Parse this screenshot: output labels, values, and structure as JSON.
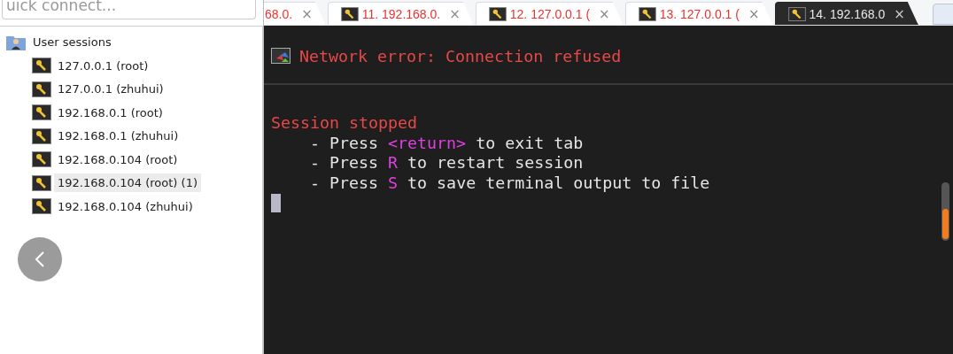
{
  "quick_connect": {
    "placeholder": "uick connect..."
  },
  "sessions": {
    "label": "User sessions",
    "children": [
      {
        "label": "127.0.0.1 (root)",
        "selected": false
      },
      {
        "label": "127.0.0.1 (zhuhui)",
        "selected": false
      },
      {
        "label": "192.168.0.1 (root)",
        "selected": false
      },
      {
        "label": "192.168.0.1 (zhuhui)",
        "selected": false
      },
      {
        "label": "192.168.0.104 (root)",
        "selected": false
      },
      {
        "label": "192.168.0.104 (root) (1)",
        "selected": true
      },
      {
        "label": "192.168.0.104 (zhuhui)",
        "selected": false
      }
    ]
  },
  "tabs": [
    {
      "label": "68.0.",
      "selected": false,
      "icon": false
    },
    {
      "label": "11. 192.168.0.",
      "selected": false,
      "icon": true
    },
    {
      "label": "12. 127.0.0.1 (",
      "selected": false,
      "icon": true
    },
    {
      "label": "13. 127.0.0.1 (",
      "selected": false,
      "icon": true
    },
    {
      "label": "14. 192.168.0",
      "selected": true,
      "icon": true
    }
  ],
  "tab_close": "×",
  "terminal": {
    "error": "Network error: Connection refused",
    "heading": "Session stopped",
    "lines": [
      [
        {
          "kind": "plain",
          "text": "    - Press "
        },
        {
          "kind": "key",
          "text": "<return>"
        },
        {
          "kind": "plain",
          "text": " to exit tab"
        }
      ],
      [
        {
          "kind": "plain",
          "text": "    - Press "
        },
        {
          "kind": "key",
          "text": "R"
        },
        {
          "kind": "plain",
          "text": " to restart session"
        }
      ],
      [
        {
          "kind": "plain",
          "text": "    - Press "
        },
        {
          "kind": "key",
          "text": "S"
        },
        {
          "kind": "plain",
          "text": " to save terminal output to file"
        }
      ]
    ]
  }
}
